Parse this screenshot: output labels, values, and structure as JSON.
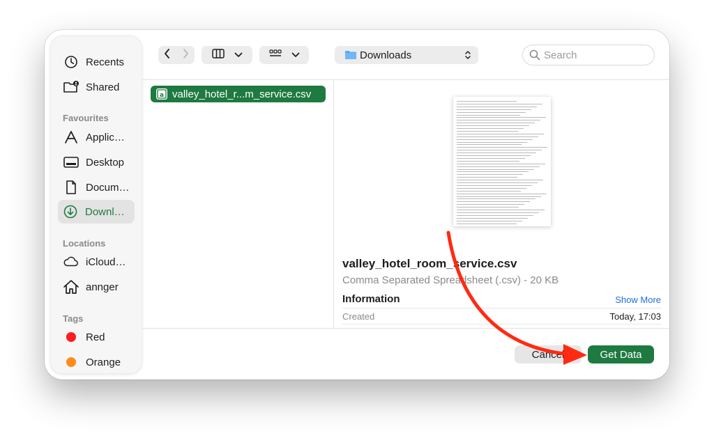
{
  "sidebar": {
    "recents": {
      "label": "Recents",
      "icon": "clock-icon"
    },
    "shared": {
      "label": "Shared",
      "icon": "shared-folder-icon"
    },
    "favourites_header": "Favourites",
    "favourites": [
      {
        "label": "Applic…",
        "icon": "applications-icon",
        "selected": false
      },
      {
        "label": "Desktop",
        "icon": "desktop-icon",
        "selected": false
      },
      {
        "label": "Docum…",
        "icon": "document-icon",
        "selected": false
      },
      {
        "label": "Downl…",
        "icon": "download-icon",
        "selected": true
      }
    ],
    "locations_header": "Locations",
    "locations": [
      {
        "label": "iCloud…",
        "icon": "cloud-icon"
      },
      {
        "label": "annger",
        "icon": "home-icon"
      }
    ],
    "tags_header": "Tags",
    "tags": [
      {
        "label": "Red",
        "color": "#ff1d1d"
      },
      {
        "label": "Orange",
        "color": "#fd8c1b"
      }
    ]
  },
  "toolbar": {
    "back_icon": "chevron-left-icon",
    "forward_icon": "chevron-right-icon",
    "view_columns_icon": "columns-view-icon",
    "grid_icon": "grid-view-icon",
    "location": "Downloads",
    "location_icon": "folder-icon",
    "search_placeholder": "Search"
  },
  "file_list": [
    {
      "name": "valley_hotel_r...m_service.csv",
      "icon": "excel-csv-icon",
      "selected": true
    }
  ],
  "preview": {
    "file_name": "valley_hotel_room_service.csv",
    "kind": "Comma Separated Spreadsheet (.csv) - 20 KB",
    "info_header": "Information",
    "show_more": "Show More",
    "created_label": "Created",
    "created_value": "Today, 17:03"
  },
  "buttons": {
    "cancel": "Cancel",
    "primary": "Get Data"
  },
  "colors": {
    "accent": "#1e7a40",
    "annotation_arrow": "#ff2a12"
  }
}
